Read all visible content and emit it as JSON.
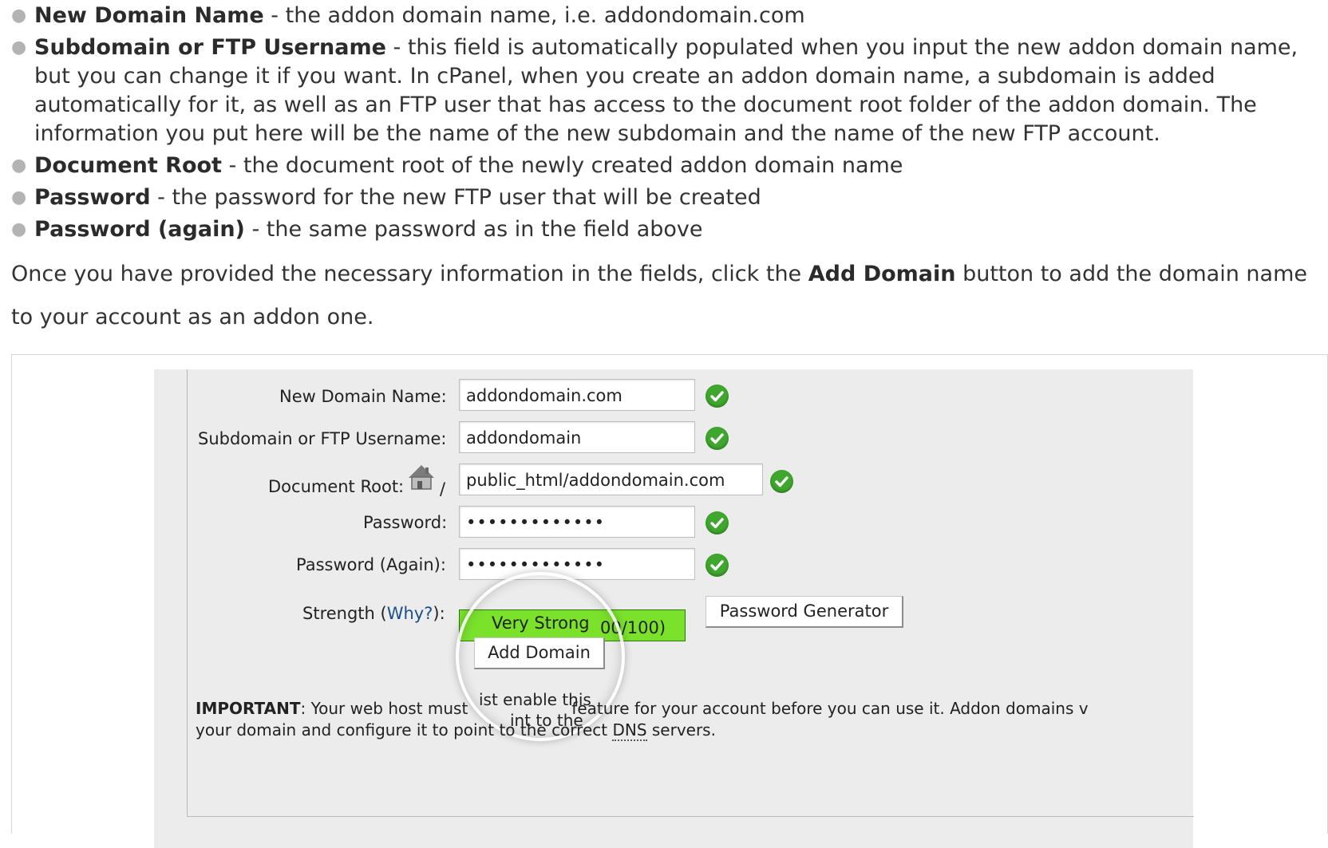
{
  "fields": [
    {
      "term": "New Domain Name",
      "desc": " - the addon domain name, i.e. addondomain.com"
    },
    {
      "term": "Subdomain or FTP Username",
      "desc": " - this field is automatically populated when you input the new addon domain name, but you can change it if you want. In cPanel, when you create an addon domain name, a subdomain is added automatically for it, as well as an FTP user that has access to the document root folder of the addon domain. The information you put here will be the name of the new subdomain and the name of the new FTP account."
    },
    {
      "term": "Document Root",
      "desc": " - the document root of the newly created addon domain name"
    },
    {
      "term": "Password",
      "desc": " - the password for the new FTP user that will be created"
    },
    {
      "term": "Password (again)",
      "desc": " - the same password as in the field above"
    }
  ],
  "outro": {
    "before": "Once you have provided the necessary information in the fields, click the ",
    "bold": "Add Domain",
    "after": " button to add the domain name to your account as an addon one."
  },
  "screenshot": {
    "new_domain_label": "New Domain Name:",
    "new_domain_value": "addondomain.com",
    "subdomain_label": "Subdomain or FTP Username:",
    "subdomain_value": "addondomain",
    "docroot_label": "Document Root:",
    "docroot_slash": "/",
    "docroot_value": "public_html/addondomain.com",
    "password_label": "Password:",
    "password_value": "•••••••••••••",
    "password_again_label": "Password (Again):",
    "password_again_value": "•••••••••••••",
    "strength_label": "Strength (",
    "strength_why": "Why?",
    "strength_label_end": "):",
    "strength_text": "Very Strong",
    "strength_score": "00/100)",
    "password_generator_label": "Password Generator",
    "add_domain_label": "Add Domain",
    "magnifier_text_1": "ist enable this",
    "magnifier_text_2": "int to the",
    "important_label": "IMPORTANT",
    "important_line1": ": Your web host must",
    "important_line1b": "feature for your account before you can use it. Addon domains v",
    "important_line2": "your domain and configure it to point to the correct ",
    "dns": "DNS",
    "important_line2b": " servers.",
    "check_color": "#3fa62e",
    "strength_color": "#7ae22b"
  }
}
